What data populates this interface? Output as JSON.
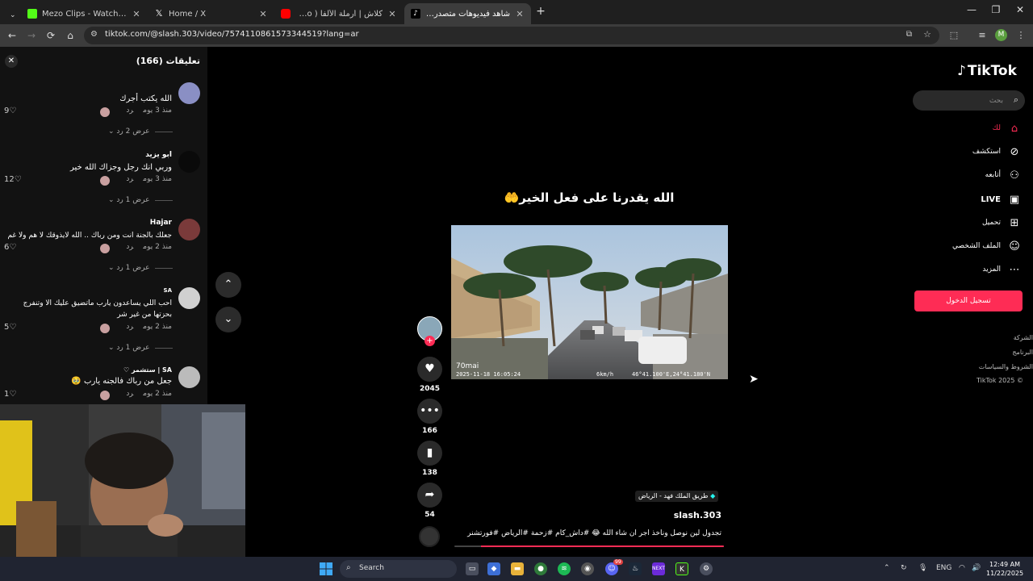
{
  "browser": {
    "tabs": [
      {
        "title": "Mezo Clips - Watch Live on Kick",
        "favicon_color": "#53fc18",
        "active": false
      },
      {
        "title": "Home / X",
        "favicon_color": "#ffffff",
        "active": false
      },
      {
        "title": "كلاش | أرملة الألفا ( Official Video",
        "favicon_color": "#ff0000",
        "active": false
      },
      {
        "title": "شاهد فيديوهات متصدرة | TikTok",
        "favicon_color": "#111111",
        "active": true
      }
    ],
    "new_tab_label": "+",
    "url": "tiktok.com/@slash.303/video/7574110861573344519?lang=ar",
    "profile_initial": "M"
  },
  "comments_panel": {
    "title": "تعليقات (166)",
    "items": [
      {
        "name": "",
        "text": "الله يكتب أجرك",
        "meta_time": "منذ 3 يوم",
        "reply_label": "رد",
        "likes": "9",
        "replies_label": "عرض 2 رد",
        "avatar_color": "#8a8fc4"
      },
      {
        "name": "ابو يزيد",
        "text": "وربي انك رجل وجزاك الله خير",
        "meta_time": "منذ 3 يوم",
        "reply_label": "رد",
        "likes": "12",
        "replies_label": "عرض 1 رد",
        "avatar_color": "#0a0a0a"
      },
      {
        "name": "Hajar",
        "text": "جعلك بالجنة انت ومن رباك .. الله لايذوقك لا هم ولا غم",
        "meta_time": "منذ 2 يوم",
        "reply_label": "رد",
        "likes": "6",
        "replies_label": "عرض 1 رد",
        "avatar_color": "#7a3a3a"
      },
      {
        "name": "SA",
        "text": "احب اللي يساعدون يارب ماتضيق عليك الا وتنفرج بحزتها من غير شر",
        "meta_time": "منذ 2 يوم",
        "reply_label": "رد",
        "likes": "5",
        "replies_label": "عرض 1 رد",
        "avatar_color": "#d0d0d0"
      },
      {
        "name": "SA | ستشمر ♡",
        "text": "جعل من رباك فالجنه يارب 🥹",
        "meta_time": "منذ 2 يوم",
        "reply_label": "رد",
        "likes": "1",
        "replies_label": "",
        "avatar_color": "#bbbbbb"
      }
    ]
  },
  "video": {
    "caption": "الله يقدرنا على فعل الخير🤲",
    "dashcam_brand": "70mai",
    "timestamp": "2025-11-18 16:05:24",
    "speed": "6km/h",
    "gps": "46°41.100'E,24°41.180'N",
    "location": "طريق الملك فهد - الرياض",
    "author": "slash.303",
    "description": "تجدول لين نوصل وناخذ اجر ان شاء الله 😂 #داش_كام #زحمة #الرياض #فورتشنر",
    "progress": 0.9
  },
  "actions": {
    "likes": "2045",
    "comments": "166",
    "saves": "138",
    "shares": "54"
  },
  "sidebar": {
    "logo": "TikTok",
    "search_placeholder": "بحث",
    "nav": [
      {
        "label": "لك",
        "icon": "home-icon",
        "active": true
      },
      {
        "label": "استكشف",
        "icon": "compass-icon",
        "active": false
      },
      {
        "label": "أتابعه",
        "icon": "following-icon",
        "active": false
      },
      {
        "label": "LIVE",
        "icon": "live-icon",
        "active": false
      },
      {
        "label": "تحميل",
        "icon": "upload-icon",
        "active": false
      },
      {
        "label": "الملف الشخصي",
        "icon": "profile-icon",
        "active": false
      },
      {
        "label": "المزيد",
        "icon": "more-icon",
        "active": false
      }
    ],
    "login_label": "تسجيل الدخول",
    "footer": [
      "الشركة",
      "البرنامج",
      "الشروط والسياسات",
      "© 2025 TikTok"
    ]
  },
  "taskbar": {
    "search_label": "Search",
    "lang": "ENG",
    "time": "12:49 AM",
    "date": "11/22/2025",
    "discord_badge": "99"
  },
  "colors": {
    "accent": "#fe2c55",
    "panel_bg": "#121212",
    "chrome_bg": "#3c3c3c"
  }
}
